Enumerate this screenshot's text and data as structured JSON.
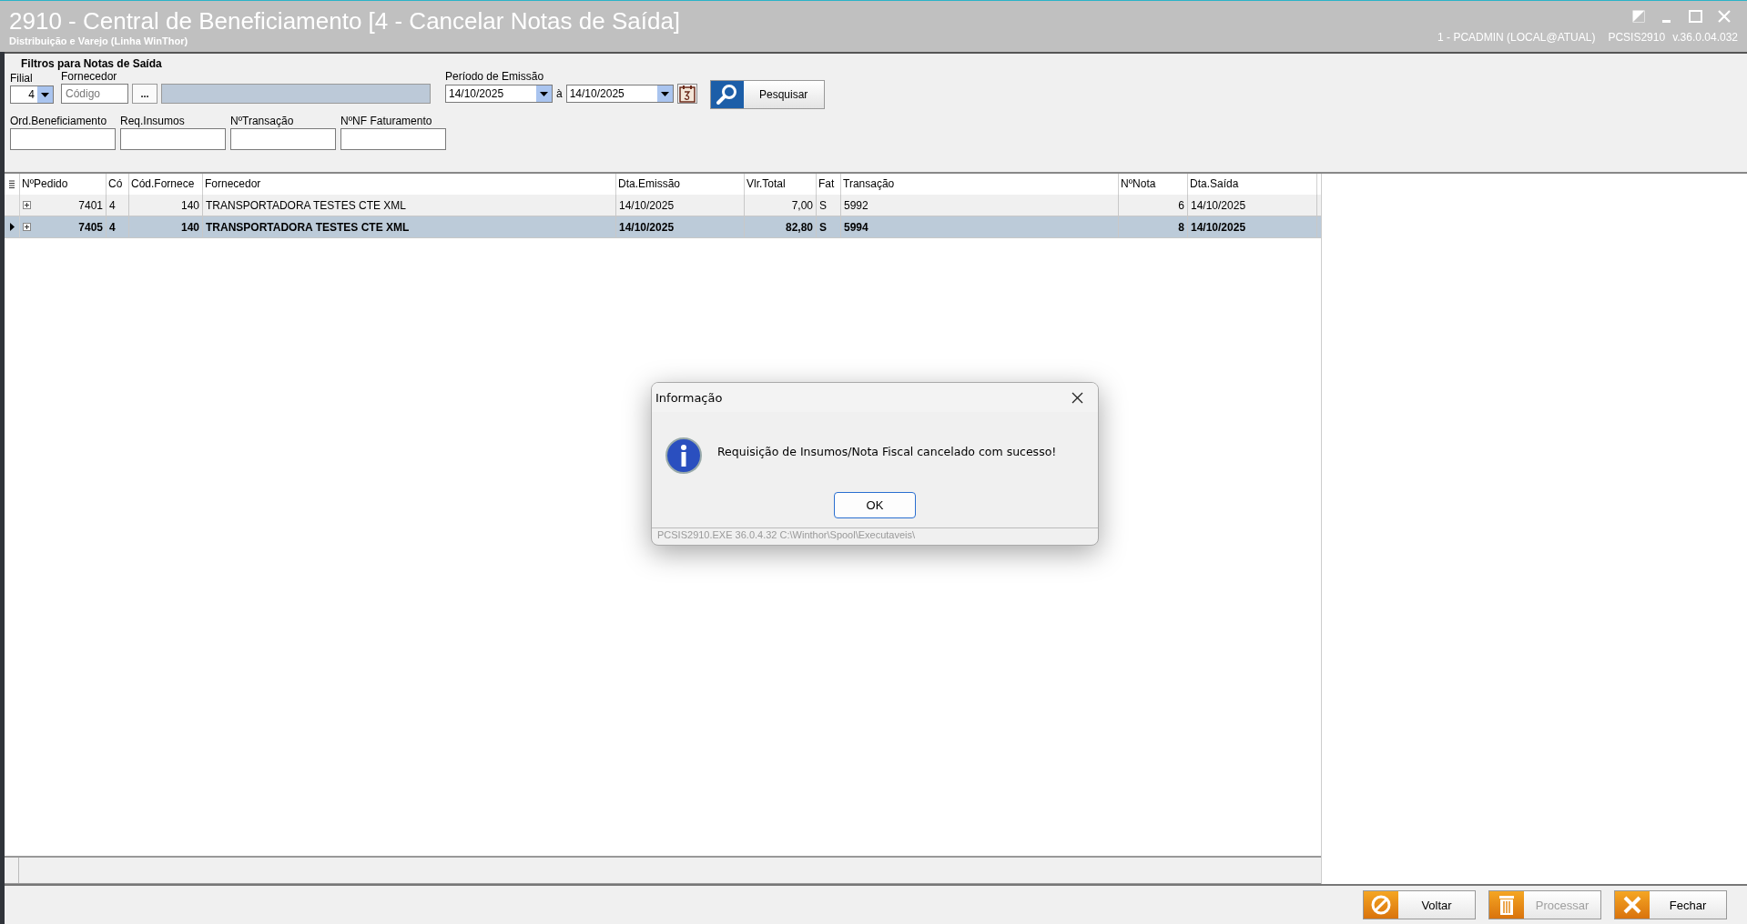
{
  "window": {
    "title": "2910 - Central de Beneficiamento [4 - Cancelar Notas de Saída]",
    "subtitle": "Distribuição e Varejo (Linha WinThor)",
    "session": "1 - PCADMIN (LOCAL@ATUAL)",
    "program": "PCSIS2910",
    "version": "v.36.0.04.032"
  },
  "filters": {
    "title": "Filtros para Notas de Saída",
    "filial": {
      "label": "Filial",
      "value": "4"
    },
    "fornecedor": {
      "label": "Fornecedor",
      "placeholder": "Código",
      "browse": "..."
    },
    "periodo": {
      "label": "Período de Emissão",
      "from": "14/10/2025",
      "separator": "à",
      "to": "14/10/2025"
    },
    "search_button": "Pesquisar",
    "fields": [
      {
        "label": "Ord.Beneficiamento"
      },
      {
        "label": "Req.Insumos"
      },
      {
        "label": "NºTransação"
      },
      {
        "label": "NºNF Faturamento"
      }
    ]
  },
  "table": {
    "columns": [
      {
        "label": "NºPedido"
      },
      {
        "label": "Có"
      },
      {
        "label": "Cód.Fornece"
      },
      {
        "label": "Fornecedor"
      },
      {
        "label": "Dta.Emissão"
      },
      {
        "label": "Vlr.Total"
      },
      {
        "label": "Fat"
      },
      {
        "label": "Transação"
      },
      {
        "label": "NºNota"
      },
      {
        "label": "Dta.Saída"
      }
    ],
    "rows": [
      {
        "selected": false,
        "cells": [
          "7401",
          "4",
          "140",
          "TRANSPORTADORA TESTES CTE XML",
          "14/10/2025",
          "7,00",
          "S",
          "5992",
          "6",
          "14/10/2025"
        ]
      },
      {
        "selected": true,
        "cells": [
          "7405",
          "4",
          "140",
          "TRANSPORTADORA TESTES CTE XML",
          "14/10/2025",
          "82,80",
          "S",
          "5994",
          "8",
          "14/10/2025"
        ]
      }
    ]
  },
  "buttons": [
    {
      "kind": "back",
      "label": "Voltar",
      "disabled": false
    },
    {
      "kind": "delete",
      "label": "Processar",
      "disabled": true
    },
    {
      "kind": "close",
      "label": "Fechar",
      "disabled": false
    }
  ],
  "dialog": {
    "title": "Informação",
    "message": "Requisição de Insumos/Nota Fiscal cancelado com sucesso!",
    "button": "OK",
    "footer": "PCSIS2910.EXE 36.0.4.32 C:\\Winthor\\Spool\\Executaveis\\"
  }
}
